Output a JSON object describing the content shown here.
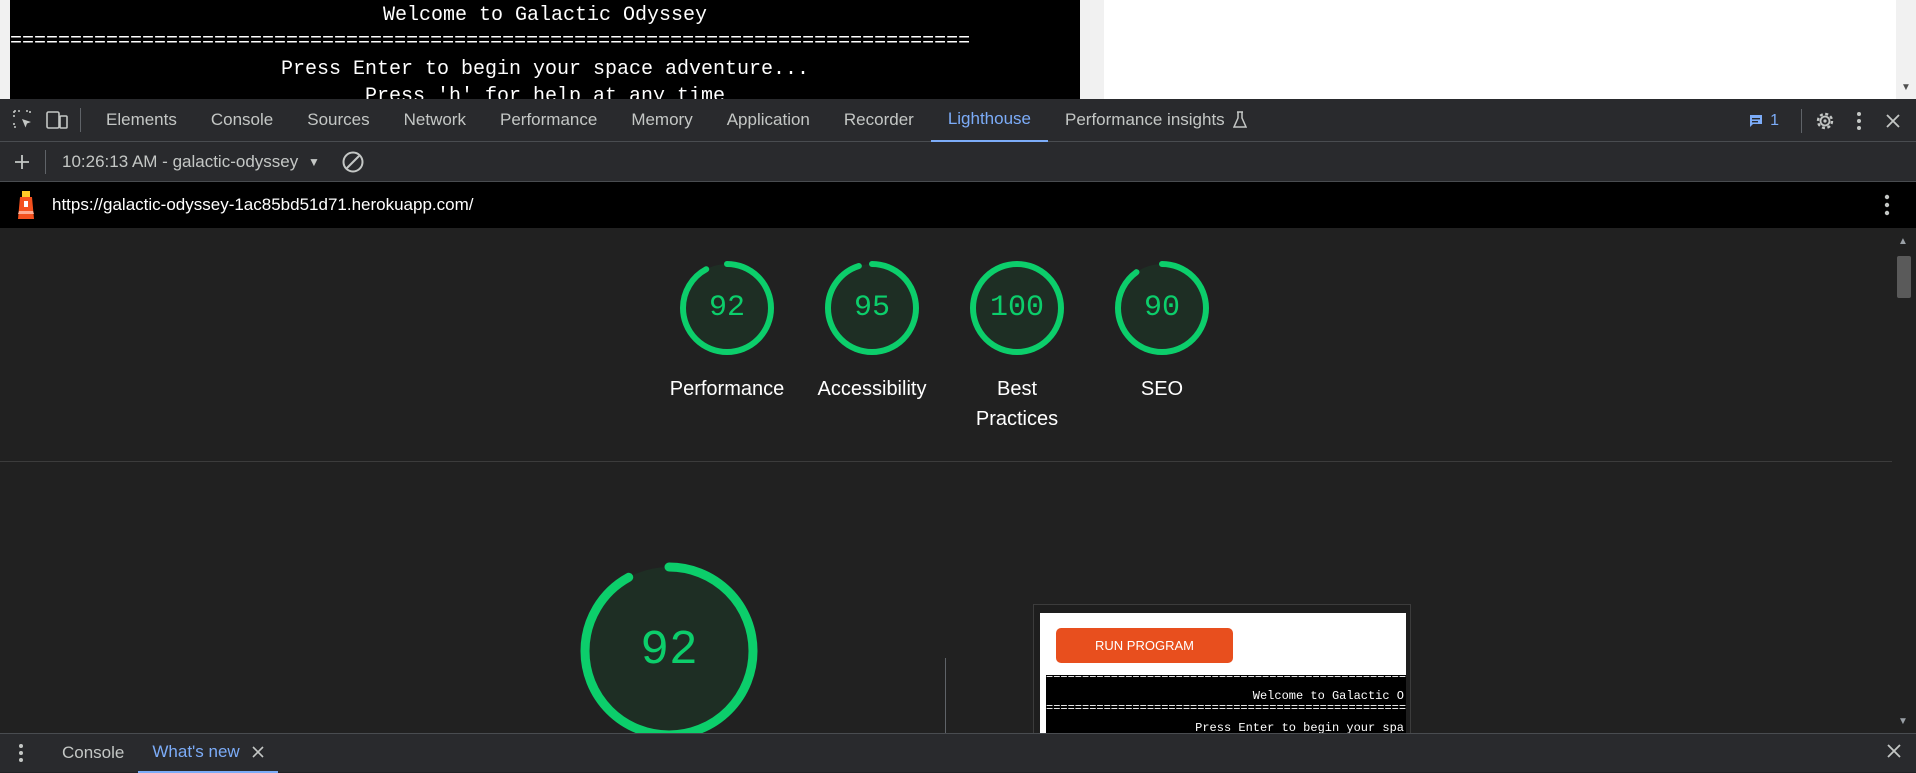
{
  "terminal": {
    "line1": "Welcome to Galactic Odyssey",
    "separator": "================================================================================",
    "line2": "Press Enter to begin your space adventure...",
    "line3": "Press 'h' for help at any time"
  },
  "devtools": {
    "tabs": [
      {
        "label": "Elements"
      },
      {
        "label": "Console"
      },
      {
        "label": "Sources"
      },
      {
        "label": "Network"
      },
      {
        "label": "Performance"
      },
      {
        "label": "Memory"
      },
      {
        "label": "Application"
      },
      {
        "label": "Recorder"
      },
      {
        "label": "Lighthouse"
      },
      {
        "label": "Performance insights"
      }
    ],
    "active_tab": "Lighthouse",
    "issues_count": "1"
  },
  "lighthouse": {
    "report_label": "10:26:13 AM - galactic-odyssey",
    "url": "https://galactic-odyssey-1ac85bd51d71.herokuapp.com/",
    "scores": [
      {
        "value": "92",
        "label": "Performance",
        "fraction": 0.92
      },
      {
        "value": "95",
        "label": "Accessibility",
        "fraction": 0.95
      },
      {
        "value": "100",
        "label": "Best Practices",
        "fraction": 1.0
      },
      {
        "value": "90",
        "label": "SEO",
        "fraction": 0.9
      }
    ],
    "big_score": {
      "value": "92",
      "fraction": 0.92
    },
    "screenshot": {
      "button_label": "RUN PROGRAM",
      "separator": "==============================================================",
      "line1": "Welcome to Galactic O",
      "line2": "Press Enter to begin your spa"
    }
  },
  "drawer": {
    "tabs": [
      {
        "label": "Console"
      },
      {
        "label": "What's new"
      }
    ]
  },
  "colors": {
    "score_green": "#0cce6b",
    "accent_blue": "#7cacf8",
    "run_button": "#e84f1e"
  }
}
